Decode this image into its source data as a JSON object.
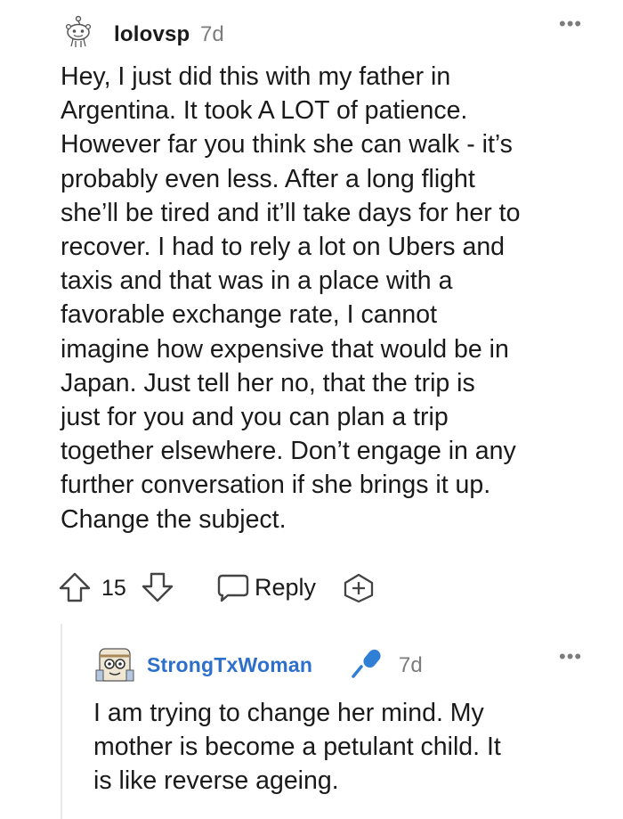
{
  "comment": {
    "username": "lolovsp",
    "time": "7d",
    "more_label": "•••",
    "body": "Hey, I just did this with my father in\nArgentina. It took A LOT of patience.\nHowever far you think she can walk - it’s\nprobably even less. After a long flight\nshe’ll be tired and it’ll take days for her to\nrecover. I had to rely a lot on Ubers and\ntaxis and that was in a place with a\nfavorable exchange rate, I cannot\nimagine how expensive that would be in\nJapan. Just tell her no, that the trip is\njust for you and you can plan a trip\ntogether elsewhere. Don’t engage in any\nfurther conversation if she brings it up.\nChange the subject.",
    "score": "15",
    "reply_label": "Reply"
  },
  "reply": {
    "username": "StrongTxWoman",
    "time": "7d",
    "more_label": "•••",
    "body": "I am trying to change her mind. My\nmother is become a petulant child. It\nis like reverse ageing."
  },
  "colors": {
    "text": "#1a1a1b",
    "meta": "#7c7c7c",
    "username_accent": "#2e6fcc",
    "thread_line": "#e8e8e8"
  },
  "icons": {
    "upvote": "arrow-up-icon",
    "downvote": "arrow-down-icon",
    "reply": "speech-bubble-icon",
    "award": "add-award-icon",
    "mic": "microphone-icon"
  }
}
